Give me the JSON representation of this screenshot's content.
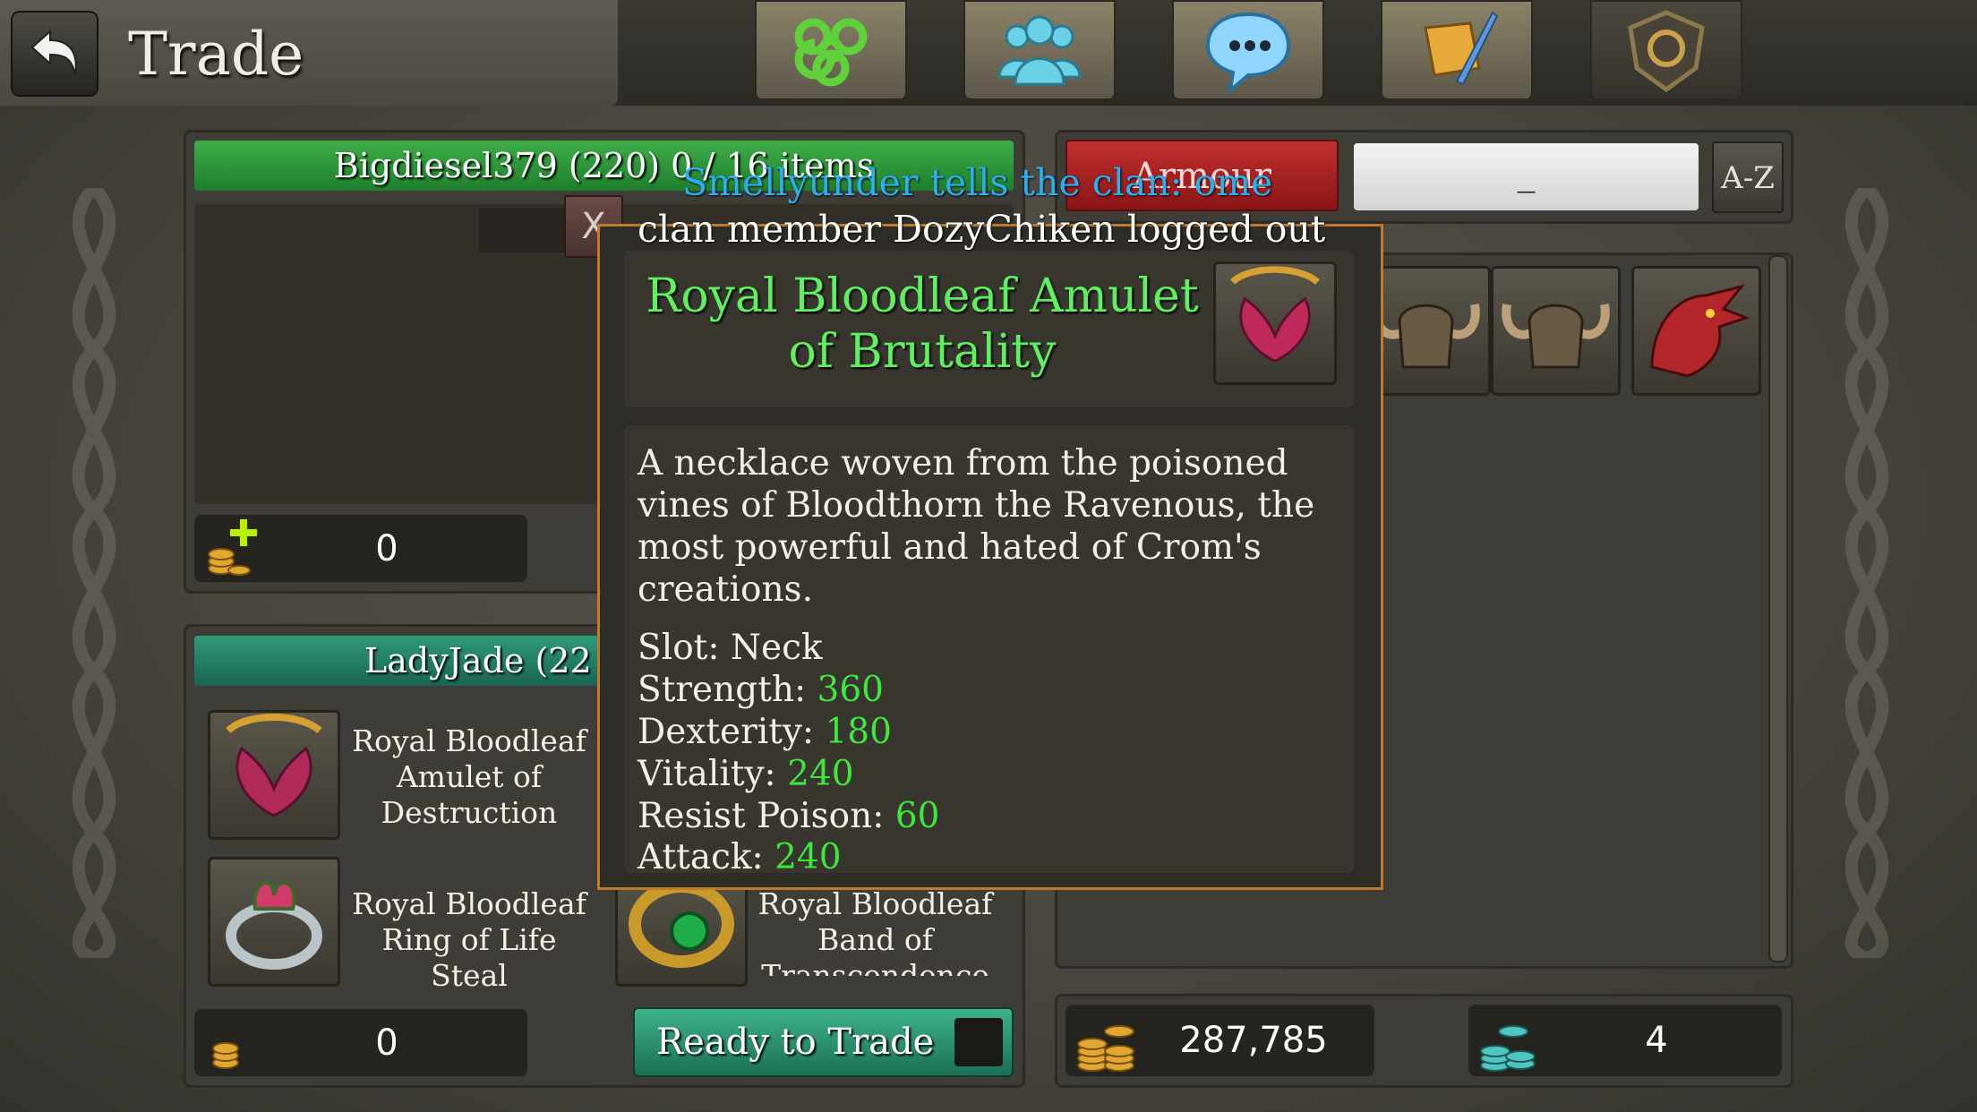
{
  "header": {
    "title": "Trade",
    "nav_icons": [
      "spiral-icon",
      "group-icon",
      "chat-icon",
      "quest-scroll-icon",
      "clan-shield-icon"
    ]
  },
  "my_offer": {
    "header": "Bigdiesel379 (220) 0 / 16 items",
    "gold": "0"
  },
  "other_offer": {
    "header": "LadyJade (22",
    "items": [
      {
        "name": "Royal Bloodleaf Amulet of Destruction"
      },
      {
        "name": "Royal Bloodleaf Ring of Life Steal"
      },
      {
        "name": "Royal Bloodleaf Band of Transcendence"
      }
    ],
    "gold": "0",
    "ready_label": "Ready to Trade"
  },
  "inventory": {
    "category": "Armour",
    "search_value": "_",
    "sort_label": "A-Z",
    "gold": "287,785",
    "gems": "4"
  },
  "chat": {
    "line1": "Smellyunder tells the clan: ome",
    "line2": "clan member DozyChiken logged out"
  },
  "tooltip": {
    "title": "Royal Bloodleaf Amulet of Brutality",
    "description": "A necklace woven from the poisoned vines of Bloodthorn the Ravenous, the most powerful and hated of Crom's creations.",
    "stats": [
      {
        "label": "Slot:",
        "value": "Neck"
      },
      {
        "label": "Strength:",
        "value": "360"
      },
      {
        "label": "Dexterity:",
        "value": "180"
      },
      {
        "label": "Vitality:",
        "value": "240"
      },
      {
        "label": "Resist Poison:",
        "value": "60"
      },
      {
        "label": "Attack:",
        "value": "240"
      }
    ],
    "close_label": "X"
  },
  "colors": {
    "green_bar": "#2b9a3a",
    "red_tab": "#b72323",
    "tooltip_border": "#c07a2c",
    "stat_green": "#3de83d",
    "chat_blue": "#2ab0f0"
  }
}
